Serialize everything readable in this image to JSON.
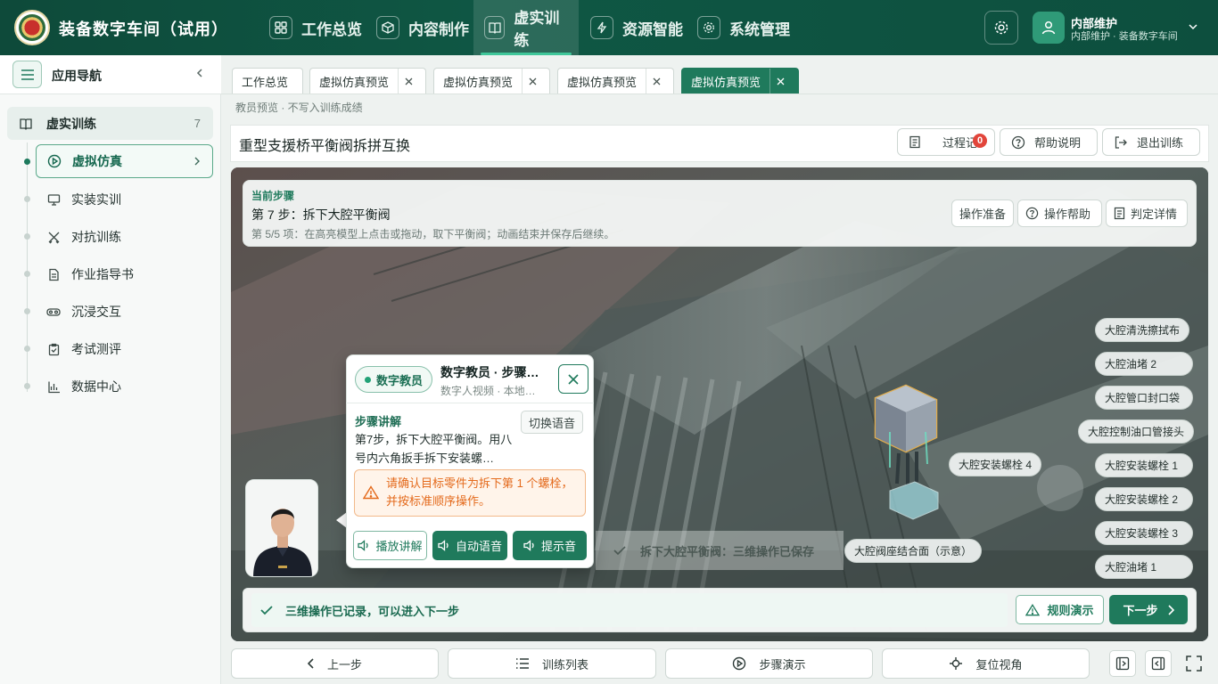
{
  "app": {
    "title": "装备数字车间（试用）"
  },
  "header": {
    "nav": [
      {
        "label": "工作总览",
        "icon": "grid-icon"
      },
      {
        "label": "内容制作",
        "icon": "cube-icon"
      },
      {
        "label": "虚实训练",
        "icon": "book-icon",
        "active": true
      },
      {
        "label": "资源智能",
        "icon": "lightning-icon"
      },
      {
        "label": "系统管理",
        "icon": "gear-icon"
      }
    ],
    "user": {
      "name": "内部维护",
      "subtitle": "内部维护 · 装备数字车间"
    }
  },
  "sidebar": {
    "title": "应用导航",
    "group": {
      "label": "虚实训练",
      "count": "7"
    },
    "items": [
      {
        "label": "虚拟仿真",
        "icon": "play-circle-icon",
        "active": true
      },
      {
        "label": "实装实训",
        "icon": "monitor-icon"
      },
      {
        "label": "对抗训练",
        "icon": "crossed-swords-icon"
      },
      {
        "label": "作业指导书",
        "icon": "document-icon"
      },
      {
        "label": "沉浸交互",
        "icon": "vr-goggles-icon"
      },
      {
        "label": "考试测评",
        "icon": "clipboard-icon"
      },
      {
        "label": "数据中心",
        "icon": "chart-icon"
      }
    ]
  },
  "tabs": [
    {
      "label": "工作总览",
      "closable": false
    },
    {
      "label": "虚拟仿真预览",
      "closable": true
    },
    {
      "label": "虚拟仿真预览",
      "closable": true
    },
    {
      "label": "虚拟仿真预览",
      "closable": true
    },
    {
      "label": "虚拟仿真预览",
      "closable": true,
      "active": true
    }
  ],
  "note": "教员预览 · 不写入训练成绩",
  "page": {
    "title": "重型支援桥平衡阀拆拼互换",
    "actions": {
      "log": "过程记",
      "log_badge": "0",
      "help": "帮助说明",
      "exit": "退出训练"
    }
  },
  "step": {
    "kicker": "当前步骤",
    "title": "第 7 步：拆下大腔平衡阀",
    "detail": "第 5/5 项：在高亮模型上点击或拖动，取下平衡阀；动画结束并保存后继续。",
    "buttons": [
      "操作准备",
      "操作帮助",
      "判定详情"
    ]
  },
  "parts": {
    "list": [
      "大腔清洗擦拭布",
      "大腔油堵 2",
      "大腔管口封口袋",
      "大腔控制油口管接头",
      "大腔安装螺栓 1",
      "大腔安装螺栓 2",
      "大腔安装螺栓 3",
      "大腔油堵 1"
    ],
    "label_bolt4": "大腔安装螺栓 4",
    "label_seat": "大腔阀座结合面（示意）"
  },
  "saved_toast": "拆下大腔平衡阀：三维操作已保存",
  "tutor": {
    "pill": "数字教员",
    "title": "数字教员 · 步骤…",
    "subtitle": "数字人视频 · 本地…",
    "section": "步骤讲解",
    "switch_voice": "切换语音",
    "explain": "第7步，拆下大腔平衡阀。用八号内六角扳手拆下安装螺…",
    "warning": "请确认目标零件为拆下第 1 个螺栓，并按标准顺序操作。",
    "buttons": {
      "play": "播放讲解",
      "auto": "自动语音",
      "tone": "提示音"
    }
  },
  "status": {
    "recorded": "三维操作已记录，可以进入下一步",
    "rule_demo": "规则演示",
    "next": "下一步"
  },
  "toolbar": {
    "prev": "上一步",
    "list": "训练列表",
    "demo": "步骤演示",
    "reset": "复位视角"
  },
  "colors": {
    "brand": "#0f5744",
    "accent": "#1f7a5c",
    "warning": "#e46a1c",
    "badge": "#e2453b"
  }
}
